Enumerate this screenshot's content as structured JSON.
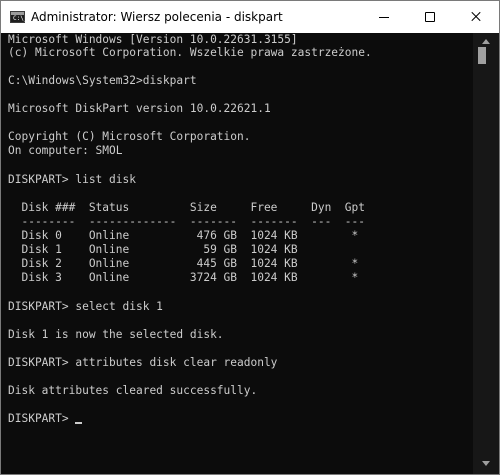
{
  "window": {
    "title": "Administrator: Wiersz polecenia - diskpart",
    "icon": "cmd-icon",
    "icon_prompt": "C:\\_"
  },
  "controls": {
    "minimize": "minimize-icon",
    "maximize": "maximize-icon",
    "close": "close-icon"
  },
  "console": {
    "background": "#0c0c0c",
    "foreground": "#cccccc",
    "lines": [
      "Microsoft Windows [Version 10.0.22631.3155]",
      "(c) Microsoft Corporation. Wszelkie prawa zastrzeżone.",
      "",
      "C:\\Windows\\System32>diskpart",
      "",
      "Microsoft DiskPart version 10.0.22621.1",
      "",
      "Copyright (C) Microsoft Corporation.",
      "On computer: SMOL",
      "",
      "DISKPART> list disk",
      "",
      "  Disk ###  Status         Size     Free     Dyn  Gpt",
      "  --------  -------------  -------  -------  ---  ---",
      "  Disk 0    Online          476 GB  1024 KB        *",
      "  Disk 1    Online           59 GB  1024 KB",
      "  Disk 2    Online          445 GB  1024 KB        *",
      "  Disk 3    Online         3724 GB  1024 KB        *",
      "",
      "DISKPART> select disk 1",
      "",
      "Disk 1 is now the selected disk.",
      "",
      "DISKPART> attributes disk clear readonly",
      "",
      "Disk attributes cleared successfully.",
      "",
      "DISKPART> "
    ]
  }
}
